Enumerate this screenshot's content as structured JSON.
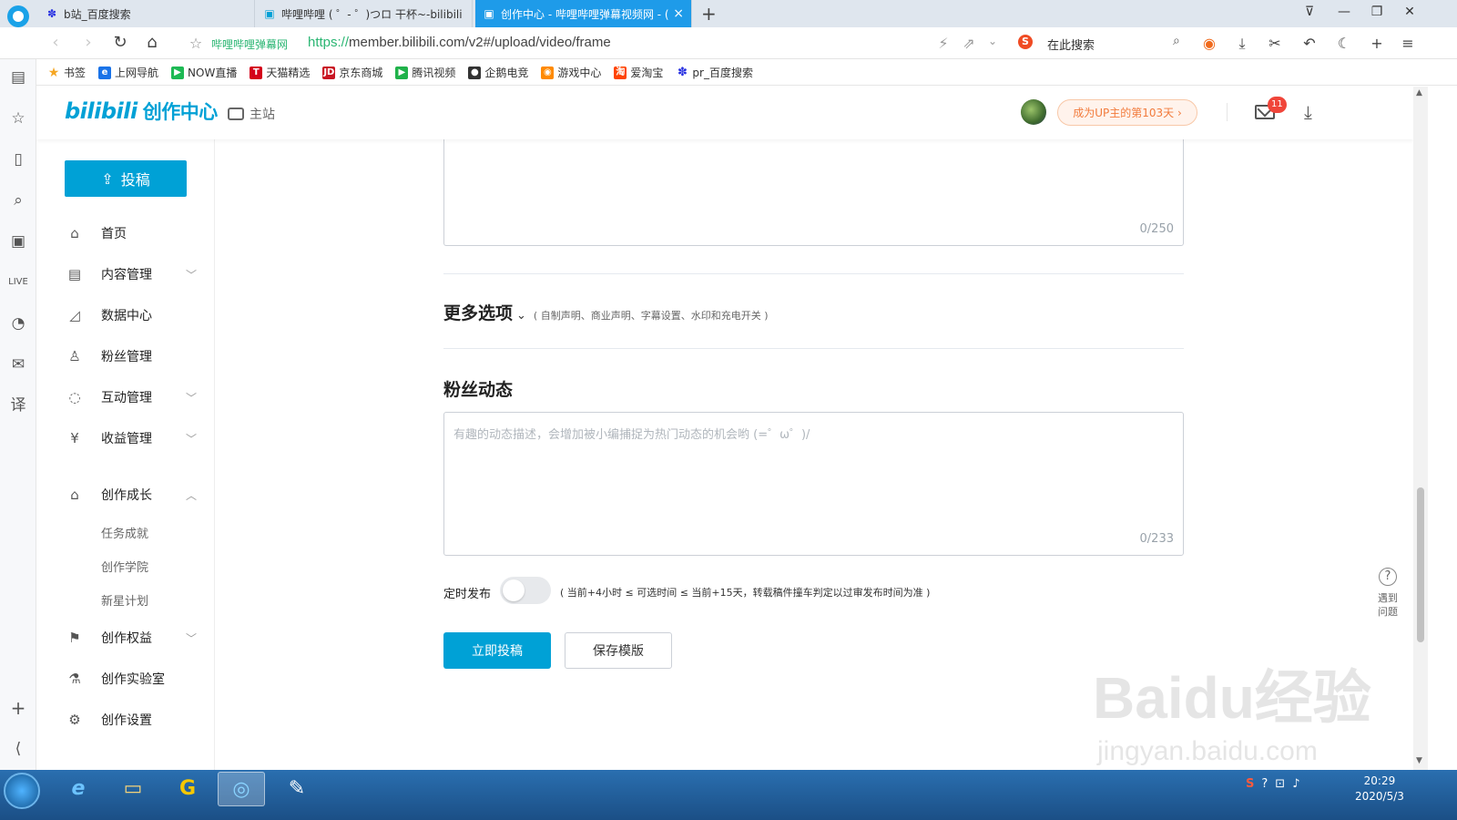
{
  "browser": {
    "tabs": [
      {
        "label": "b站_百度搜索",
        "icon": "baidu-paw-icon"
      },
      {
        "label": "哔哩哔哩 ( ゜- ゜)つロ 干杯~-bilibili",
        "icon": "bilibili-tv-icon"
      },
      {
        "label": "创作中心 - 哔哩哔哩弹幕视频网 - (",
        "icon": "bilibili-tv-icon",
        "active": true
      }
    ],
    "new_tab": "+",
    "site_name": "哔哩哔哩弹幕网",
    "url_protocol": "https://",
    "url_rest": "member.bilibili.com/v2#/upload/video/frame",
    "search_placeholder": "在此搜索",
    "search_engine_logo": "S",
    "bookmarks": [
      {
        "label": "书签",
        "color": "#f5a623"
      },
      {
        "label": "上网导航",
        "color": "#1a73e8"
      },
      {
        "label": "NOW直播",
        "color": "#1db954"
      },
      {
        "label": "天猫精选",
        "color": "#d4001a"
      },
      {
        "label": "京东商城",
        "color": "#c91623"
      },
      {
        "label": "腾讯视频",
        "color": "#20b24a"
      },
      {
        "label": "企鹅电竞",
        "color": "#333333"
      },
      {
        "label": "游戏中心",
        "color": "#ff8a00"
      },
      {
        "label": "爱淘宝",
        "color": "#ff4400"
      },
      {
        "label": "pr_百度搜索",
        "color": "#2932e1"
      }
    ]
  },
  "header": {
    "logo_text": "bilibili",
    "logo_suffix": "创作中心",
    "main_site": "主站",
    "up_days": "成为UP主的第103天 ›",
    "notification_count": "11"
  },
  "nav": {
    "upload_label": "投稿",
    "items": [
      {
        "label": "首页",
        "icon": "home-icon",
        "glyph": "⌂"
      },
      {
        "label": "内容管理",
        "icon": "content-icon",
        "glyph": "▤"
      },
      {
        "label": "数据中心",
        "icon": "chart-icon",
        "glyph": "◿"
      },
      {
        "label": "粉丝管理",
        "icon": "fans-icon",
        "glyph": "♙"
      },
      {
        "label": "互动管理",
        "icon": "comment-icon",
        "glyph": "◌"
      },
      {
        "label": "收益管理",
        "icon": "money-bag-icon",
        "glyph": "¥"
      },
      {
        "label": "创作成长",
        "icon": "graduation-cap-icon",
        "glyph": "⌂"
      },
      {
        "label": "创作权益",
        "icon": "flag-icon",
        "glyph": "⚑"
      },
      {
        "label": "创作实验室",
        "icon": "flask-icon",
        "glyph": "⚗"
      },
      {
        "label": "创作设置",
        "icon": "settings-icon",
        "glyph": "⚙"
      }
    ],
    "sub_items": [
      "任务成就",
      "创作学院",
      "新星计划"
    ]
  },
  "form": {
    "desc_counter": "0/250",
    "more_options_title": "更多选项",
    "more_options_desc": "( 自制声明、商业声明、字幕设置、水印和充电开关 )",
    "fans_title": "粉丝动态",
    "fans_placeholder": "有趣的动态描述，会增加被小编捕捉为热门动态的机会哟 (=゜ω゜)/",
    "fans_counter": "0/233",
    "schedule_label": "定时发布",
    "schedule_enabled": false,
    "schedule_note": "( 当前+4小时 ≤ 可选时间 ≤ 当前+15天，转载稿件撞车判定以过审发布时间为准 )",
    "submit_label": "立即投稿",
    "template_label": "保存模版"
  },
  "help": {
    "label_line1": "遇到",
    "label_line2": "问题",
    "glyph": "?"
  },
  "watermark": {
    "main": "Baidu经验",
    "sub": "jingyan.baidu.com"
  },
  "taskbar": {
    "time": "20:29",
    "date": "2020/5/3",
    "apps": [
      {
        "name": "ie-icon",
        "glyph": "e"
      },
      {
        "name": "folder-icon",
        "glyph": "▭"
      },
      {
        "name": "game-icon",
        "glyph": "G"
      },
      {
        "name": "browser-icon",
        "glyph": "◎",
        "active": true
      },
      {
        "name": "paint-icon",
        "glyph": "✎"
      }
    ]
  }
}
